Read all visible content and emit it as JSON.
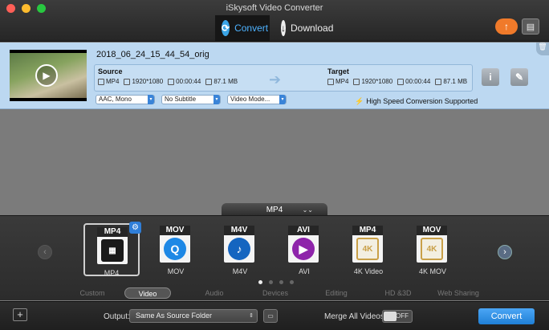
{
  "window": {
    "title": "iSkysoft Video Converter"
  },
  "toolbar": {
    "tabs": [
      {
        "label": "Convert",
        "icon": "convert-icon",
        "active": true
      },
      {
        "label": "Download",
        "icon": "download-icon",
        "active": false
      }
    ],
    "upgrade_icon": "upload-icon",
    "tool_icon": "toolbox-icon"
  },
  "file": {
    "name": "2018_06_24_15_44_54_orig",
    "source": {
      "heading": "Source",
      "format": "MP4",
      "resolution": "1920*1080",
      "duration": "00:00:44",
      "size": "87.1 MB"
    },
    "target": {
      "heading": "Target",
      "format": "MP4",
      "resolution": "1920*1080",
      "duration": "00:00:44",
      "size": "87.1 MB"
    },
    "audio_option": "AAC, Mono",
    "subtitle_option": "No Subtitle",
    "video_mode_option": "Video Mode...",
    "high_speed_text": "High Speed Conversion Supported"
  },
  "format_panel": {
    "current_format": "MP4",
    "formats": [
      {
        "tag": "MP4",
        "label": "MP4",
        "icon": "film-icon",
        "selected": true,
        "color": "#1a1a1a"
      },
      {
        "tag": "MOV",
        "label": "MOV",
        "icon": "quicktime-icon",
        "selected": false,
        "color": "#1e88e5"
      },
      {
        "tag": "M4V",
        "label": "M4V",
        "icon": "music-note-icon",
        "selected": false,
        "color": "#1565c0"
      },
      {
        "tag": "AVI",
        "label": "AVI",
        "icon": "play-disc-icon",
        "selected": false,
        "color": "#8e24aa"
      },
      {
        "tag": "MP4",
        "label": "4K Video",
        "icon": "4k-icon",
        "badge": "4K",
        "selected": false,
        "color": "#c9a048"
      },
      {
        "tag": "MOV",
        "label": "4K MOV",
        "icon": "4k-icon",
        "badge": "4K",
        "selected": false,
        "color": "#c9a048"
      }
    ],
    "page_count": 4,
    "current_page": 1,
    "categories": [
      "Custom",
      "Video",
      "Audio",
      "Devices",
      "Editing",
      "HD &3D",
      "Web Sharing"
    ],
    "active_category": "Video"
  },
  "bottom": {
    "output_label": "Output:",
    "output_value": "Same As Source Folder",
    "merge_label": "Merge All Videos:",
    "merge_state": "OFF",
    "convert_label": "Convert"
  }
}
